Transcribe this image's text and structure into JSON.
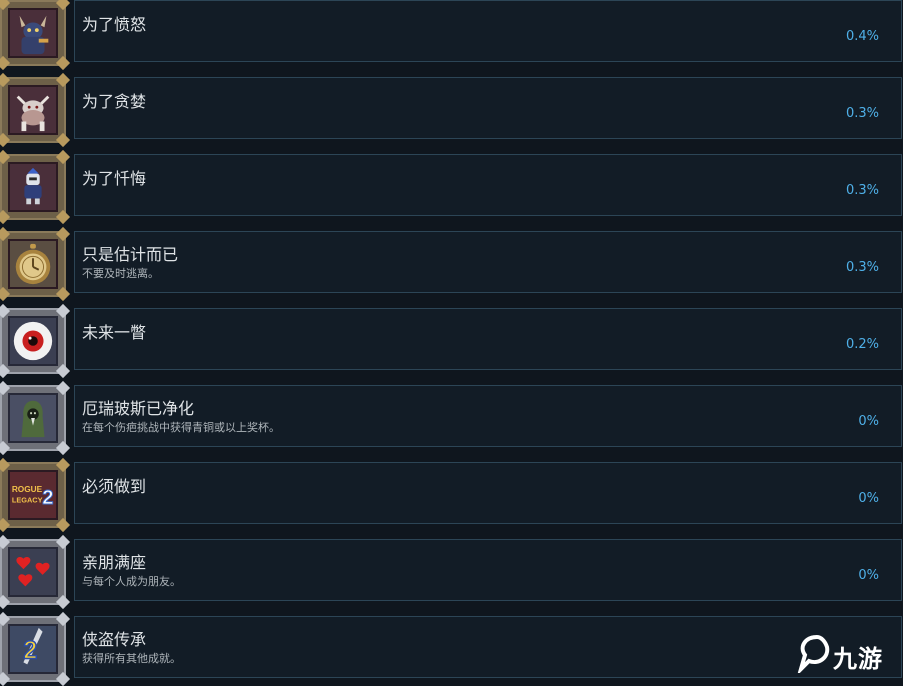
{
  "achievements": [
    {
      "title": "为了愤怒",
      "desc": "",
      "percent": "0.4%",
      "icon": "horned-demon-icon",
      "frame": "gold"
    },
    {
      "title": "为了贪婪",
      "desc": "",
      "percent": "0.3%",
      "icon": "beast-creature-icon",
      "frame": "gold"
    },
    {
      "title": "为了忏悔",
      "desc": "",
      "percent": "0.3%",
      "icon": "knight-character-icon",
      "frame": "gold"
    },
    {
      "title": "只是估计而已",
      "desc": "不要及时逃离。",
      "percent": "0.3%",
      "icon": "pocket-watch-icon",
      "frame": "gold"
    },
    {
      "title": "未来一瞥",
      "desc": "",
      "percent": "0.2%",
      "icon": "eye-icon",
      "frame": "silver"
    },
    {
      "title": "厄瑞玻斯已净化",
      "desc": "在每个伤疤挑战中获得青铜或以上奖杯。",
      "percent": "0%",
      "icon": "hooded-figure-icon",
      "frame": "silver"
    },
    {
      "title": "必须做到",
      "desc": "",
      "percent": "0%",
      "icon": "rogue-legacy-2-logo-icon",
      "frame": "gold"
    },
    {
      "title": "亲朋满座",
      "desc": "与每个人成为朋友。",
      "percent": "0%",
      "icon": "hearts-icon",
      "frame": "silver"
    },
    {
      "title": "侠盗传承",
      "desc": "获得所有其他成就。",
      "percent": "",
      "icon": "sword-number-2-icon",
      "frame": "silver"
    }
  ],
  "logo_text": {
    "line1": "ROGUE",
    "line2": "LEGACY",
    "num": "2"
  },
  "watermark": {
    "text": "九游",
    "icon": "jiuyou-logo-icon"
  },
  "colors": {
    "percent": "#4fb0e8",
    "card_border": "#2c4556",
    "background": "#0f161e"
  }
}
